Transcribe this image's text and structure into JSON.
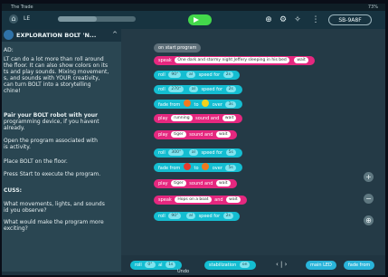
{
  "statusbar": {
    "left": "The Trade",
    "right": "73%"
  },
  "topbar": {
    "title": "LE",
    "speed_level": 0.5,
    "robot": "SB-9A8F"
  },
  "left": {
    "header": "EXPLORATION BOLT 'N...",
    "lines": [
      "AD:",
      "LT can do a lot more than roll around",
      "the floor. It can also show colors on its",
      "ts and play sounds. Mixing movement,",
      "s, and sounds with YOUR creativity,",
      "can turn BOLT into a storytelling",
      "chine!",
      "Pair your BOLT robot with your",
      "programming device, if you havent",
      "already.",
      "Open the program associated with",
      "is activity.",
      "Place BOLT on the floor.",
      "Press Start to execute the program.",
      "CUSS:",
      "What movements, lights, and sounds",
      "id you observe?",
      "What would make the program more",
      "exciting?"
    ]
  },
  "program": {
    "start": "on start program",
    "speak1": {
      "verb": "speak",
      "text": "One dark and stormy night Jeffery sleeping in his bed",
      "mode": "wait"
    },
    "roll1": {
      "verb": "roll",
      "angle": "90°",
      "speed": "al",
      "speed_lbl": "speed for",
      "time": "2s"
    },
    "roll2": {
      "verb": "roll",
      "angle": "270°",
      "speed": "al",
      "speed_lbl": "speed for",
      "time": "2s"
    },
    "fade1": {
      "verb": "fade from",
      "to": "to",
      "over": "over",
      "time": "3s"
    },
    "sound1": {
      "verb": "play",
      "name": "running",
      "mid": "sound and",
      "mode": "wait"
    },
    "sound2": {
      "verb": "play",
      "name": "tiger",
      "mid": "sound and",
      "mode": "wait"
    },
    "roll3": {
      "verb": "roll",
      "angle": "300°",
      "speed": "al",
      "speed_lbl": "speed for",
      "time": "5s"
    },
    "fade2": {
      "verb": "fade from",
      "to": "to",
      "over": "over",
      "time": "5s"
    },
    "sound3": {
      "verb": "play",
      "name": "tiger",
      "mid": "sound and",
      "mode": "wait"
    },
    "speak2": {
      "verb": "speak",
      "text": "Hops on a boat",
      "mid": "and",
      "mode": "wait"
    },
    "roll4": {
      "verb": "roll",
      "angle": "90°",
      "speed": "al",
      "speed_lbl": "speed for",
      "time": "2s"
    }
  },
  "bottom": {
    "roll": {
      "verb": "roll",
      "angle": "0°",
      "speed_lbl": "al",
      "time": "1s"
    },
    "stabilization": {
      "label": "stabilization",
      "value": "on"
    },
    "arrows": "‹ | ›",
    "undo": "Undo",
    "main_led": "main LED",
    "fade": "fade from"
  },
  "colors": {
    "pink": "#e5287f",
    "cyan": "#14bdd1",
    "orange": "#f07a1e",
    "red": "#e63a2e",
    "yellow": "#f2d21a",
    "green": "#3fbf46"
  }
}
